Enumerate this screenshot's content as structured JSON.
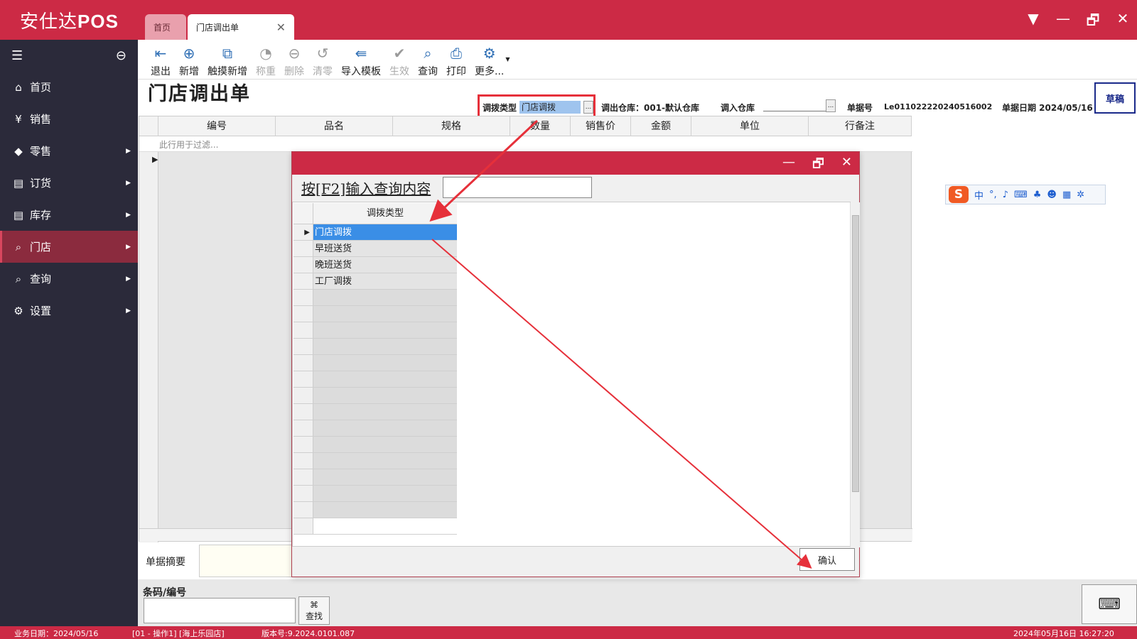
{
  "app": {
    "brand_text": "安仕达",
    "brand_bold": "POS"
  },
  "tabs": [
    {
      "label": "首页"
    },
    {
      "label": "门店调出单"
    }
  ],
  "window_buttons": {
    "dropdown": "▼",
    "minimize": "—",
    "restore": "🗗",
    "close": "✕"
  },
  "sidebar": {
    "items": [
      {
        "label": "首页",
        "icon": "home-icon"
      },
      {
        "label": "销售",
        "icon": "yuan-icon"
      },
      {
        "label": "零售",
        "icon": "tag-icon"
      },
      {
        "label": "订货",
        "icon": "database-icon"
      },
      {
        "label": "库存",
        "icon": "database-icon"
      },
      {
        "label": "门店",
        "icon": "search-icon",
        "active": true
      },
      {
        "label": "查询",
        "icon": "search-icon"
      },
      {
        "label": "设置",
        "icon": "gear-icon"
      }
    ]
  },
  "toolbar": {
    "exit": "退出",
    "new": "新增",
    "touch_new": "触摸新增",
    "weigh": "称重",
    "delete": "删除",
    "clear": "清零",
    "import_template": "导入模板",
    "effective": "生效",
    "query": "查询",
    "print": "打印",
    "more": "更多..."
  },
  "page": {
    "title": "门店调出单",
    "transfer_type_label": "调拨类型",
    "transfer_type_value": "门店调拨",
    "out_warehouse": "调出仓库：001-默认仓库",
    "in_warehouse_label": "调入仓库",
    "doc_no_label": "单据号",
    "doc_no_value": "Le011022220240516002",
    "doc_date": "单据日期 2024/05/16",
    "status": "草稿"
  },
  "grid": {
    "columns": [
      "编号",
      "品名",
      "规格",
      "数量",
      "销售价",
      "金额",
      "单位",
      "行备注"
    ],
    "filter_placeholder": "此行用于过滤..."
  },
  "bottom": {
    "summary_label": "单据摘要",
    "barcode_label": "条码/编号",
    "find_button": "查找"
  },
  "dialog": {
    "prompt": "按[F2]输入查询内容",
    "column": "调拨类型",
    "rows": [
      "门店调拨",
      "早班送货",
      "晚班送货",
      "工厂调拨"
    ],
    "confirm": "确认"
  },
  "ime": {
    "lang": "中",
    "punct": "°,"
  },
  "statusbar": {
    "business_date": "业务日期：2024/05/16",
    "operator": "[01 - 操作1]  [海上乐园店]",
    "version": "版本号:9.2024.0101.087",
    "datetime": "2024年05月16日 16:27:20"
  },
  "colors": {
    "brand": "#cc2a45",
    "sidebar": "#2b2a3a",
    "active_item": "#8b2b3e",
    "annotation": "#e6303a",
    "selection": "#3a8ee6"
  }
}
